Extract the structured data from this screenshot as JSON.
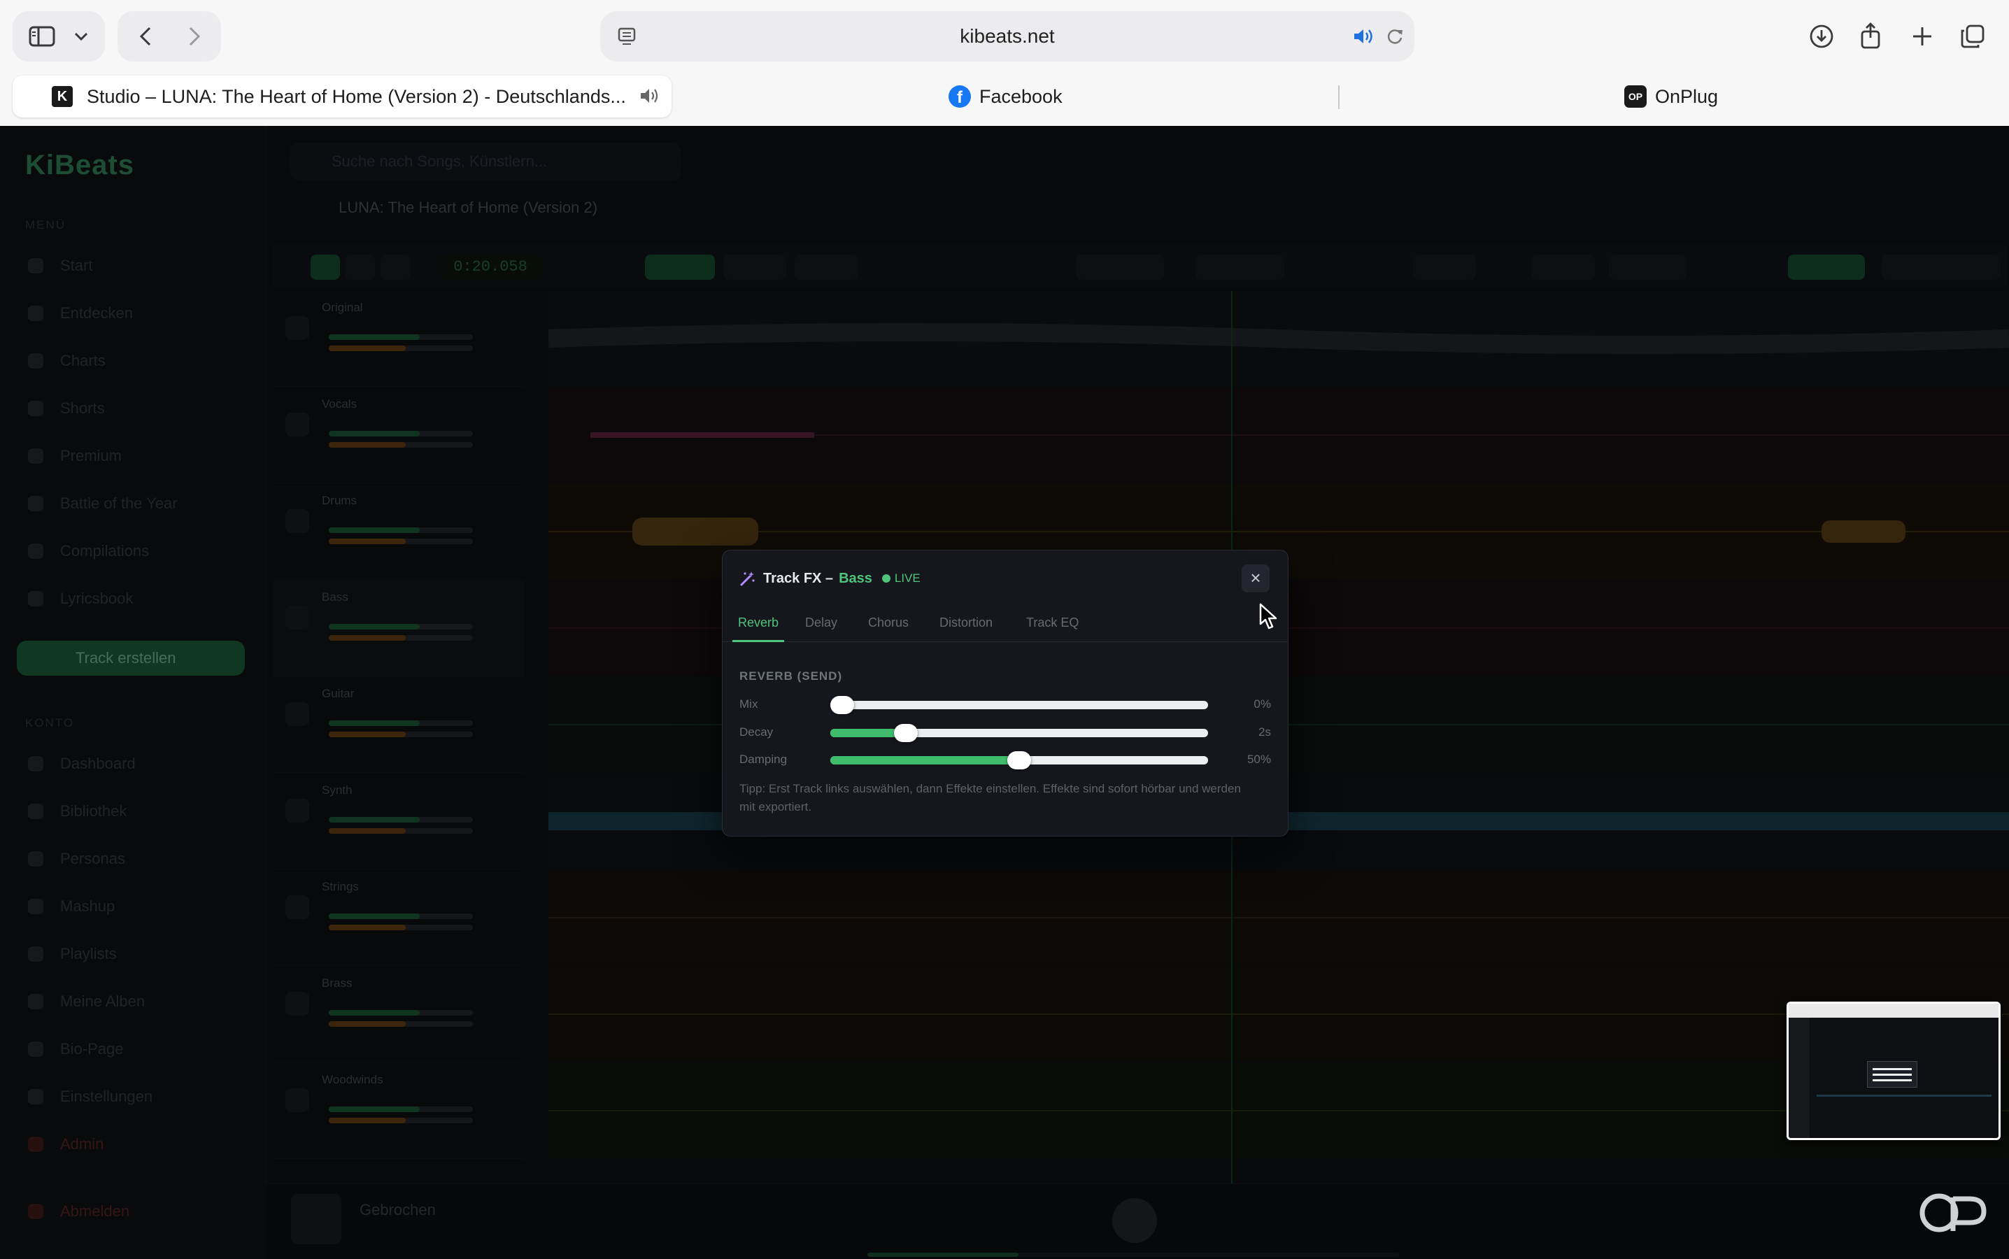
{
  "browser": {
    "url": "kibeats.net",
    "tabs": [
      {
        "label": "Studio – LUNA: The Heart of Home (Version 2) - Deutschlands...",
        "active": true
      },
      {
        "label": "Facebook",
        "active": false
      },
      {
        "label": "OnPlug",
        "active": false
      }
    ]
  },
  "app": {
    "logo": "KiBeats",
    "search_placeholder": "Suche nach Songs, Künstlern...",
    "project_title": "LUNA: The Heart of Home (Version 2)",
    "time": "0:20.058",
    "sections": {
      "menu": "MENÜ",
      "account": "KONTO"
    },
    "nav_menu": [
      "Start",
      "Entdecken",
      "Charts",
      "Shorts",
      "Premium",
      "Battle of the Year",
      "Compilations",
      "Lyricsbook"
    ],
    "create_track": "Track erstellen",
    "nav_account": [
      "Dashboard",
      "Bibliothek",
      "Personas",
      "Mashup",
      "Playlists",
      "Meine Alben",
      "Bio-Page",
      "Einstellungen",
      "Admin"
    ],
    "logout": "Abmelden",
    "tracks": [
      "Original",
      "Vocals",
      "Drums",
      "Bass",
      "Guitar",
      "Synth",
      "Strings",
      "Brass",
      "Woodwinds"
    ],
    "now_playing": "Gebrochen"
  },
  "modal": {
    "title": "Track FX –",
    "track_name": "Bass",
    "live": "LIVE",
    "close": "×",
    "tabs": [
      "Reverb",
      "Delay",
      "Chorus",
      "Distortion",
      "Track EQ"
    ],
    "active_tab": "Reverb",
    "section": "REVERB (SEND)",
    "params": [
      {
        "label": "Mix",
        "value": "0%",
        "level": 0.0
      },
      {
        "label": "Decay",
        "value": "2s",
        "level": 0.2
      },
      {
        "label": "Damping",
        "value": "50%",
        "level": 0.5
      }
    ],
    "tip": "Tipp: Erst Track links auswählen, dann Effekte einstellen. Effekte sind sofort hörbar und werden mit exportiert."
  },
  "colors": {
    "accent": "#4ec47c",
    "slider_fill": "#3fbd6c"
  },
  "icons": [
    "sidebar-toggle-icon",
    "chevron-down-icon",
    "back-icon",
    "forward-icon",
    "reader-icon",
    "speaker-icon",
    "reload-icon",
    "download-icon",
    "share-icon",
    "plus-icon",
    "tabs-overview-icon",
    "wand-icon",
    "close-icon",
    "cursor-icon"
  ]
}
